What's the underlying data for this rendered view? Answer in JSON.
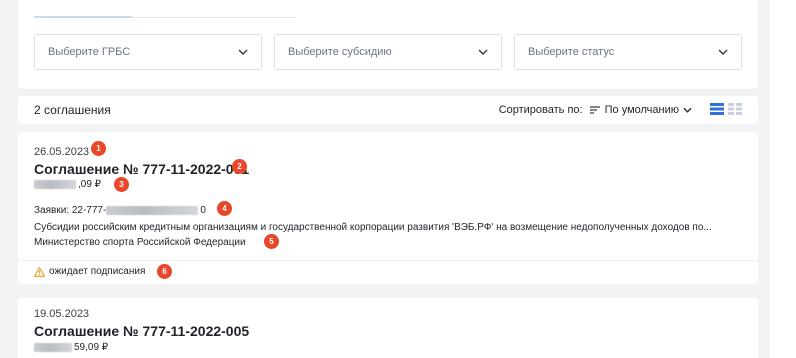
{
  "filters": {
    "grbs_placeholder": "Выберите ГРБС",
    "subsidy_placeholder": "Выберите субсидию",
    "status_placeholder": "Выберите статус"
  },
  "list": {
    "count_label": "2 соглашения",
    "sort_label": "Сортировать по:",
    "sort_value": "По умолчанию"
  },
  "agreements": [
    {
      "date": "26.05.2023",
      "title": "Соглашение № 777-11-2022-001",
      "amount_suffix": ",09 ₽",
      "applications_prefix": "Заявки: 22-777-",
      "applications_suffix": "0",
      "description": "Субсидии российским кредитным организациям и государственной корпорации развития 'ВЭБ.РФ' на возмещение недополученных доходов по...",
      "ministry": "Министерство спорта Российской Федерации",
      "status": "ожидает подписания"
    },
    {
      "date": "19.05.2023",
      "title": "Соглашение № 777-11-2022-005",
      "amount_suffix": "59,09 ₽"
    }
  ],
  "markers": [
    "1",
    "2",
    "3",
    "4",
    "5",
    "6"
  ],
  "colors": {
    "marker": "#e8472a",
    "warning": "#f29b1d",
    "view_active": "#2f6fd8",
    "view_inactive": "#c9d2dc"
  },
  "icons": [
    "chevron-down-icon",
    "sort-lines-icon",
    "list-view-icon",
    "grid-view-icon",
    "warning-triangle-icon"
  ]
}
